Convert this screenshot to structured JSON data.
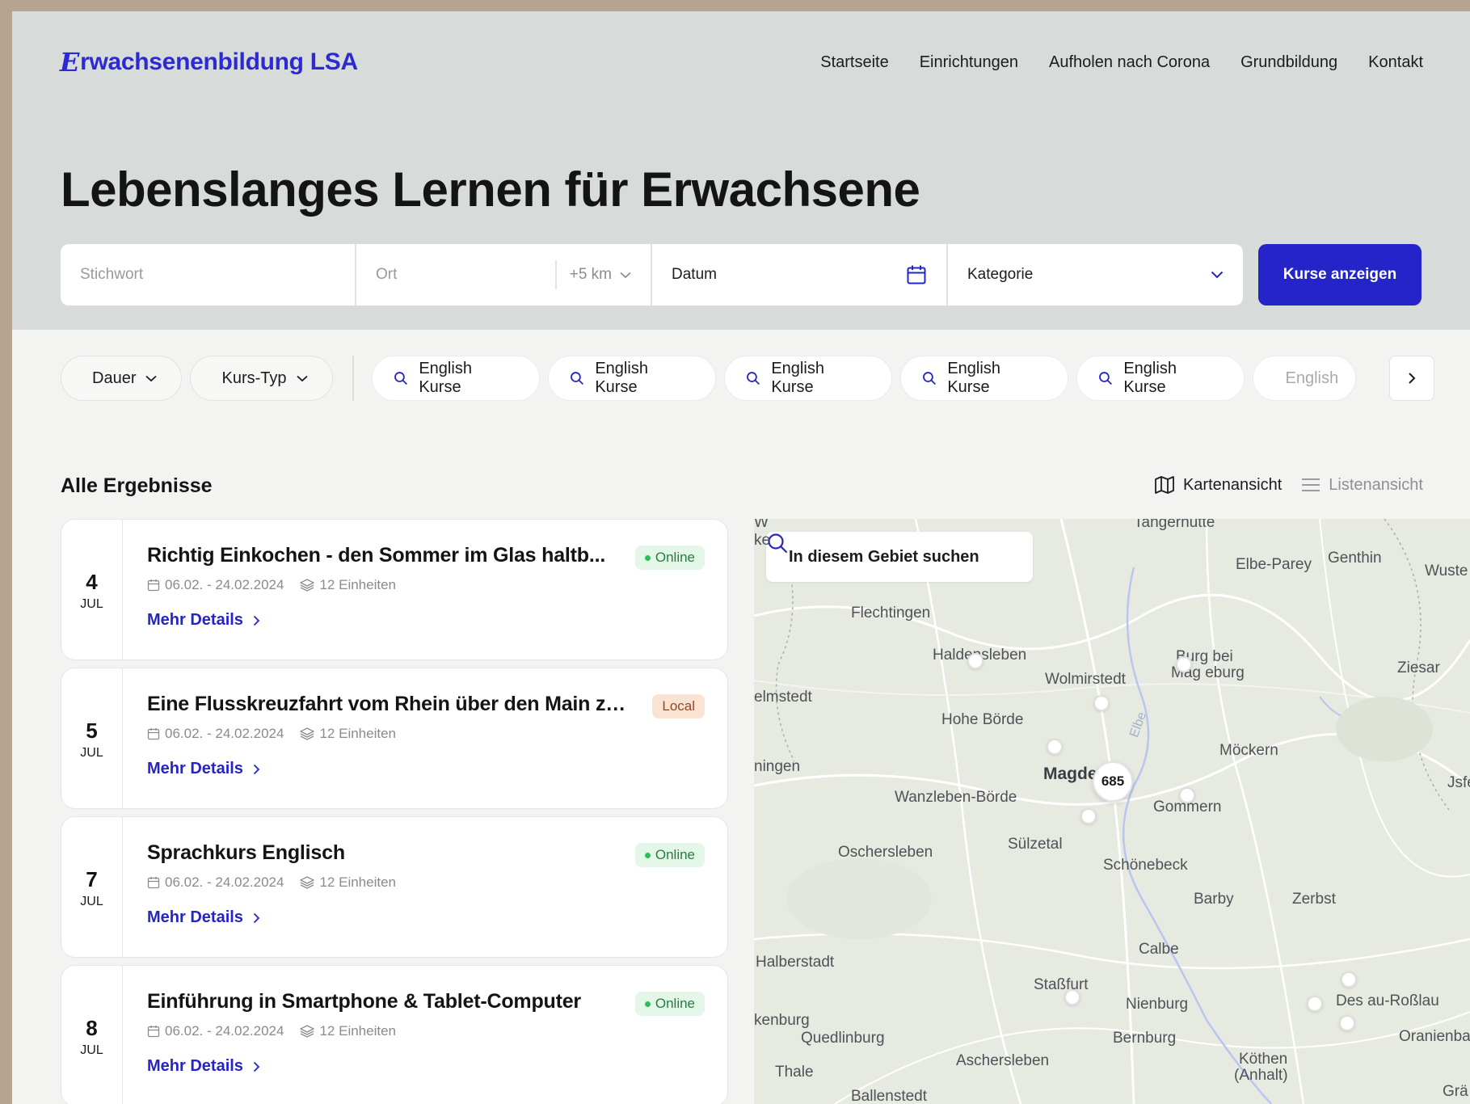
{
  "brand": {
    "logo_mark": "E",
    "logo_text": "rwachsenenbildung LSA"
  },
  "nav": [
    "Startseite",
    "Einrichtungen",
    "Aufholen nach Corona",
    "Grundbildung",
    "Kontakt"
  ],
  "hero": {
    "title": "Lebenslanges Lernen für Erwachsene"
  },
  "search": {
    "keyword_placeholder": "Stichwort",
    "location_placeholder": "Ort",
    "radius": "+5 km",
    "date": "Datum",
    "category": "Kategorie",
    "submit_label": "Kurse anzeigen"
  },
  "filters": {
    "dropdowns": [
      "Dauer",
      "Kurs-Typ"
    ],
    "chips": [
      "English Kurse",
      "English Kurse",
      "English Kurse",
      "English Kurse",
      "English Kurse",
      "English"
    ]
  },
  "results": {
    "title": "Alle Ergebnisse",
    "view_map": "Kartenansicht",
    "view_list": "Listenansicht",
    "items": [
      {
        "day": "4",
        "month": "JUL",
        "title": "Richtig Einkochen - den Sommer im Glas haltb...",
        "dates": "06.02. - 24.02.2024",
        "units": "12 Einheiten",
        "badge": "Online",
        "link": "Mehr Details"
      },
      {
        "day": "5",
        "month": "JUL",
        "title": "Eine Flusskreuzfahrt vom Rhein über den Main zu...",
        "dates": "06.02. - 24.02.2024",
        "units": "12 Einheiten",
        "badge": "Local",
        "link": "Mehr Details"
      },
      {
        "day": "7",
        "month": "JUL",
        "title": "Sprachkurs Englisch",
        "dates": "06.02. - 24.02.2024",
        "units": "12 Einheiten",
        "badge": "Online",
        "link": "Mehr Details"
      },
      {
        "day": "8",
        "month": "JUL",
        "title": "Einführung in Smartphone & Tablet-Computer",
        "dates": "06.02. - 24.02.2024",
        "units": "12 Einheiten",
        "badge": "Online",
        "link": "Mehr Details"
      }
    ]
  },
  "map": {
    "search_label": "In diesem Gebiet suchen",
    "cluster_count": "685",
    "places": [
      "Flechtingen",
      "Haldensleben",
      "Wolmirstedt",
      "Burg bei",
      "Mag  eburg",
      "Genthin",
      "Elbe-Parey",
      "Wuste",
      "Ziesar",
      "Tangerhütte",
      "Hohe Börde",
      "elmstedt",
      "ningen",
      "Magde",
      "Möckern",
      "Wanzleben-Börde",
      "Gommern",
      "Oschersleben",
      "Sülzetal",
      "Schönebeck",
      "Barby",
      "Zerbst",
      "Calbe",
      "Halberstadt",
      "Staßfurt",
      "Nienburg",
      "Des  au-Roßlau",
      "Oranienba",
      "kenburg",
      "Quedlinburg",
      "Bernburg",
      "Aschersleben",
      "Köthen",
      "(Anhalt)",
      "Thale",
      "Ballenstedt",
      "Grä",
      "Elbe",
      "ke",
      "Jsfelde",
      "W"
    ]
  },
  "colors": {
    "accent": "#2424c9",
    "hero_bg": "#d7dcdb",
    "online_bg": "#e4f6e8",
    "local_bg": "#fbe3d4"
  }
}
